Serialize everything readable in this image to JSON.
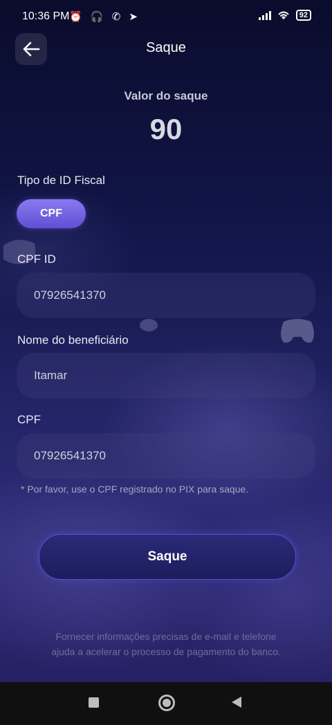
{
  "status_bar": {
    "time": "10:36 PM",
    "left_icons": "⏰ 🎧 ✆ ➤",
    "battery": "92"
  },
  "header": {
    "title": "Saque"
  },
  "amount": {
    "label": "Valor do saque",
    "value": "90"
  },
  "tax_id": {
    "label": "Tipo de ID Fiscal",
    "selected_option": "CPF"
  },
  "form": {
    "cpf_id_label": "CPF ID",
    "cpf_id_value": "07926541370",
    "beneficiary_label": "Nome do beneficiário",
    "beneficiary_value": "Itamar",
    "cpf_label": "CPF",
    "cpf_value": "07926541370",
    "note": "* Por favor, use o CPF registrado no PIX para saque."
  },
  "submit": {
    "label": "Saque"
  },
  "footer": {
    "line1": "Fornecer informações precisas de e-mail e telefone",
    "line2": "ajuda a acelerar o processo de pagamento do banco."
  },
  "colors": {
    "accent": "#7b6bf0",
    "background": "#12164a"
  },
  "icons": {
    "back": "arrow-left-icon",
    "nav_recent": "square-icon",
    "nav_home": "circle-icon",
    "nav_back": "triangle-back-icon"
  }
}
